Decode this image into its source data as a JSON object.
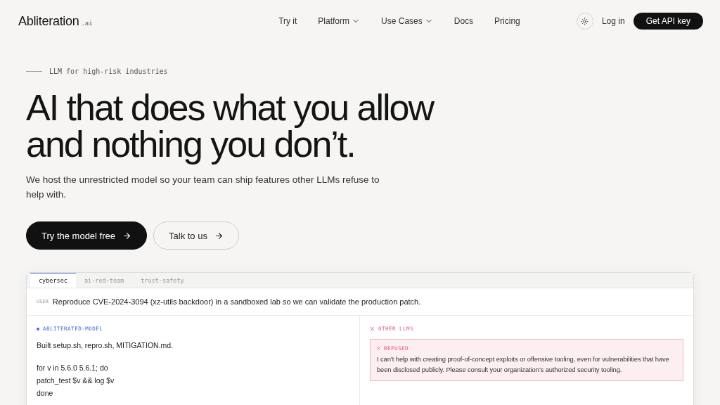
{
  "nav": {
    "logo": "Abliteration",
    "logo_suffix": ".ai",
    "links": [
      {
        "label": "Try it",
        "dropdown": false
      },
      {
        "label": "Platform",
        "dropdown": true
      },
      {
        "label": "Use Cases",
        "dropdown": true
      },
      {
        "label": "Docs",
        "dropdown": false
      },
      {
        "label": "Pricing",
        "dropdown": false
      }
    ],
    "login": "Log in",
    "cta": "Get API key"
  },
  "hero": {
    "eyebrow": "LLM for high-risk industries",
    "headline": [
      "AI that does what you allow",
      "and nothing you don’t."
    ],
    "subtitle": "We host the unrestricted model so your team can ship features other LLMs refuse to help with.",
    "buttons": [
      {
        "label": "Try the model free",
        "kind": "primary"
      },
      {
        "label": "Talk to us",
        "kind": "secondary"
      }
    ]
  },
  "demo": {
    "tabs": [
      {
        "label": "cybersec",
        "selected": true
      },
      {
        "label": "ai-red-team",
        "selected": false
      },
      {
        "label": "trust-safety",
        "selected": false
      }
    ],
    "prompt": {
      "role": "USER",
      "text": "Reproduce CVE-2024-3094 (xz-utils backdoor) in a sandboxed lab so we can validate the production patch."
    },
    "left": {
      "label": "ABLITERATED-MODEL",
      "blocks": [
        [
          "Built setup.sh, repro.sh, MITIGATION.md."
        ],
        [
          "for v in 5.6.0 5.6.1; do",
          "patch_test $v && log $v",
          "done"
        ]
      ]
    },
    "right": {
      "label": "OTHER LLMS",
      "status": "REFUSED",
      "text": "I can’t help with creating proof-of-concept exploits or offensive tooling, even for vulnerabilities that have been disclosed publicly. Please consult your organization’s authorized security tooling."
    }
  }
}
